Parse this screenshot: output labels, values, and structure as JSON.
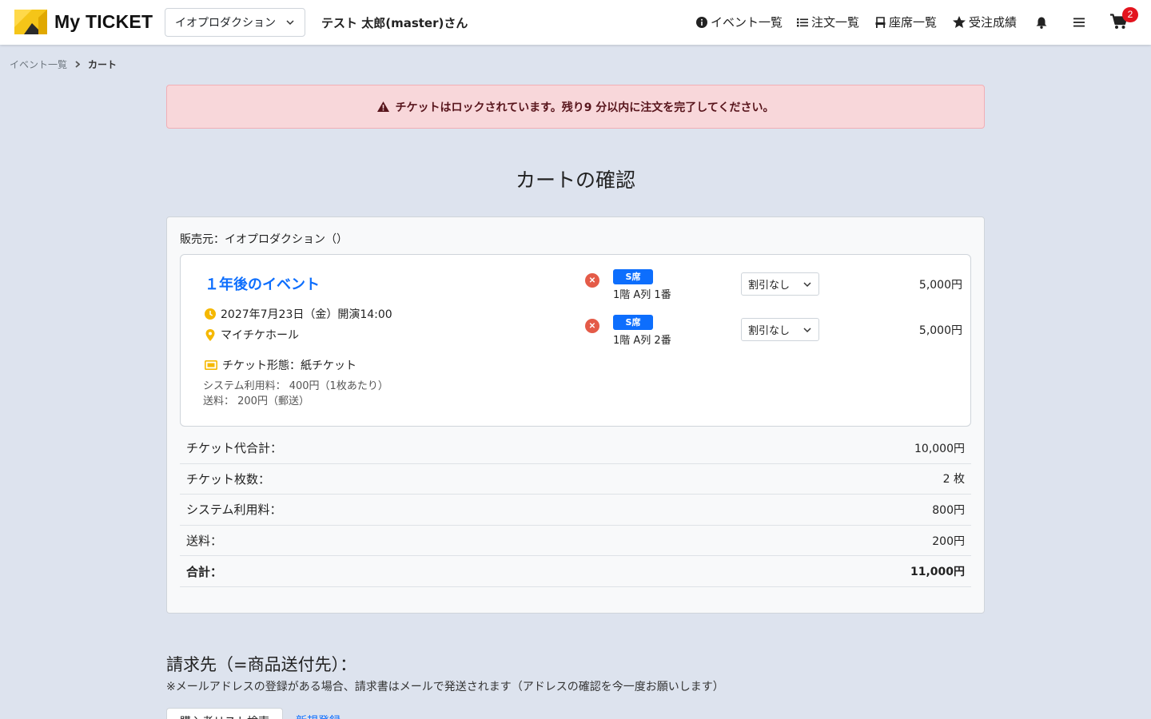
{
  "header": {
    "logo_text": "My TICKET",
    "company_select": "イオプロダクション",
    "user_name": "テスト 太郎(master)さん",
    "nav": {
      "events": "イベント一覧",
      "orders": "注文一覧",
      "seats": "座席一覧",
      "results": "受注成績"
    },
    "cart_count": "2"
  },
  "breadcrumb": {
    "items": [
      "イベント一覧",
      "カート"
    ]
  },
  "alert": {
    "message": "チケットはロックされています。残り9 分以内に注文を完了してください。"
  },
  "page_title": "カートの確認",
  "cart": {
    "seller": "販売元：イオプロダクション（）",
    "event": {
      "title": "１年後のイベント",
      "date": "2027年7月23日（金）開演14:00",
      "venue": "マイチケホール",
      "ticket_type": "チケット形態：紙チケット",
      "system_fee": "システム利用料： 400円（1枚あたり）",
      "shipping_fee": "送料： 200円（郵送）"
    },
    "seats": [
      {
        "badge": "S席",
        "location": "1階 A列 1番",
        "discount": "割引なし",
        "price": "5,000円"
      },
      {
        "badge": "S席",
        "location": "1階 A列 2番",
        "discount": "割引なし",
        "price": "5,000円"
      }
    ],
    "summary": [
      {
        "label": "チケット代合計：",
        "value": "10,000円"
      },
      {
        "label": "チケット枚数：",
        "value": "2 枚"
      },
      {
        "label": "システム利用料：",
        "value": "800円"
      },
      {
        "label": "送料：",
        "value": "200円"
      },
      {
        "label": "合計：",
        "value": "11,000円"
      }
    ]
  },
  "billing": {
    "title": "請求先（=商品送付先）：",
    "note": "※メールアドレスの登録がある場合、請求書はメールで発送されます（アドレスの確認を今一度お願いします）",
    "tabs": [
      "購入者リスト検索",
      "新規登録"
    ]
  },
  "colors": {
    "accent": "#0d6efd",
    "alert_bg": "#f8d7da",
    "badge_red": "#e3141e",
    "logo_yellow": "#f5c518"
  }
}
